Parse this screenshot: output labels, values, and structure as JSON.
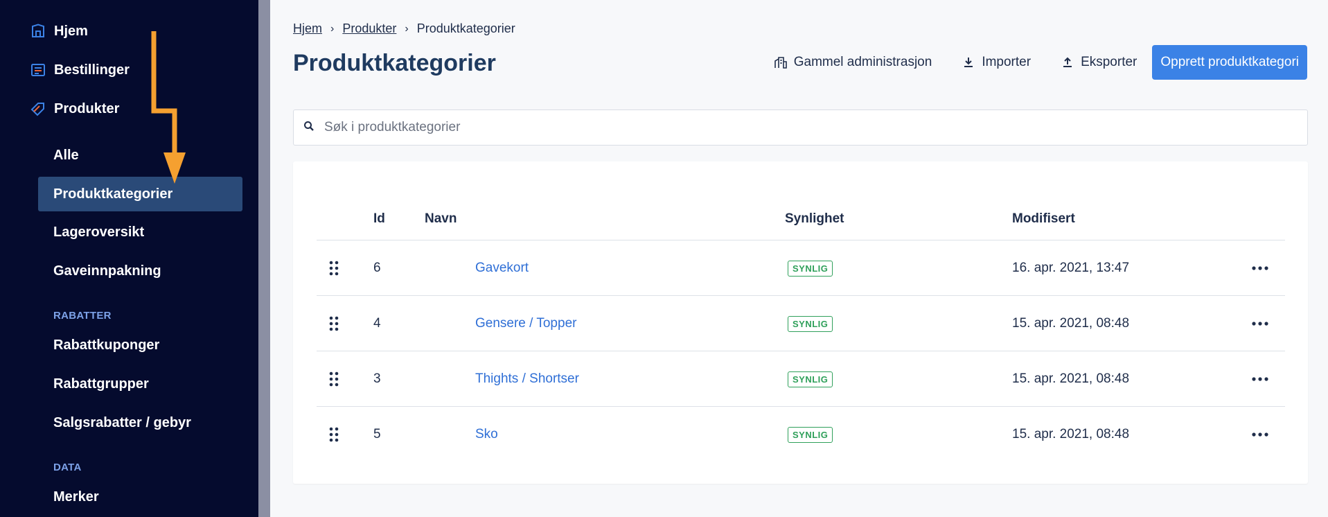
{
  "sidebar": {
    "top_items": [
      {
        "label": "Hjem",
        "icon": "home-icon"
      },
      {
        "label": "Bestillinger",
        "icon": "orders-icon"
      },
      {
        "label": "Produkter",
        "icon": "tag-icon"
      }
    ],
    "sub_items": [
      {
        "label": "Alle"
      },
      {
        "label": "Produktkategorier",
        "active": true
      },
      {
        "label": "Lageroversikt"
      },
      {
        "label": "Gaveinnpakning"
      }
    ],
    "sections": [
      {
        "title": "RABATTER",
        "items": [
          "Rabattkuponger",
          "Rabattgrupper",
          "Salgsrabatter / gebyr"
        ]
      },
      {
        "title": "DATA",
        "items": [
          "Merker"
        ]
      }
    ]
  },
  "breadcrumb": {
    "home": "Hjem",
    "products": "Produkter",
    "current": "Produktkategorier"
  },
  "page": {
    "title": "Produktkategorier"
  },
  "toolbar": {
    "legacy_admin": "Gammel administrasjon",
    "import": "Importer",
    "export": "Eksporter",
    "create": "Opprett produktkategori"
  },
  "search": {
    "placeholder": "Søk i produktkategorier"
  },
  "table": {
    "headers": {
      "id": "Id",
      "name": "Navn",
      "visibility": "Synlighet",
      "modified": "Modifisert"
    },
    "rows": [
      {
        "id": "6",
        "name": "Gavekort",
        "visibility": "SYNLIG",
        "modified": "16. apr. 2021, 13:47"
      },
      {
        "id": "4",
        "name": "Gensere / Topper",
        "visibility": "SYNLIG",
        "modified": "15. apr. 2021, 08:48"
      },
      {
        "id": "3",
        "name": "Thights / Shortser",
        "visibility": "SYNLIG",
        "modified": "15. apr. 2021, 08:48"
      },
      {
        "id": "5",
        "name": "Sko",
        "visibility": "SYNLIG",
        "modified": "15. apr. 2021, 08:48"
      }
    ]
  },
  "colors": {
    "sidebar_bg": "#050b2e",
    "active_item": "#2a4a78",
    "section_title": "#7da2e8",
    "primary": "#3b82e6",
    "link": "#2f6fd6",
    "badge_green": "#2fa05a",
    "annotation_arrow": "#f5a030"
  }
}
